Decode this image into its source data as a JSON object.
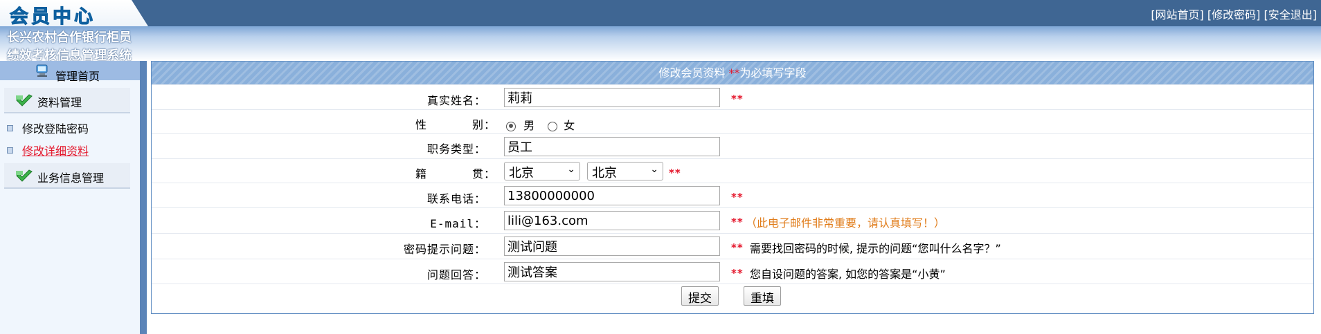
{
  "header": {
    "logo_text": "会员中心",
    "system_title_line1": "长兴农村合作银行柜员",
    "system_title_line2": "绩效考核信息管理系统",
    "links": [
      "[网站首页]",
      "[修改密码]",
      "[安全退出]"
    ]
  },
  "sidebar": {
    "home_label": "管理首页",
    "groups": [
      {
        "label": "资料管理",
        "items": [
          {
            "label": "修改登陆密码",
            "active": false
          },
          {
            "label": "修改详细资料",
            "active": true
          }
        ]
      },
      {
        "label": "业务信息管理",
        "items": []
      }
    ]
  },
  "form": {
    "header_title": "修改会员资料",
    "header_required_mark": "**",
    "header_required_text": "为必填写字段",
    "required_mark": "**",
    "fields": {
      "real_name": {
        "label": "真实姓名：",
        "value": "莉莉"
      },
      "gender": {
        "label_a": "性",
        "label_b": "别：",
        "options": [
          "男",
          "女"
        ],
        "selected": "男"
      },
      "job_type": {
        "label": "职务类型：",
        "value": "员工"
      },
      "origin": {
        "label_a": "籍",
        "label_b": "贯：",
        "province": "北京",
        "city": "北京"
      },
      "phone": {
        "label": "联系电话：",
        "value": "13800000000"
      },
      "email": {
        "label": "E-mail：",
        "value": "lili@163.com",
        "note": "（此电子邮件非常重要，请认真填写！）"
      },
      "question": {
        "label": "密码提示问题：",
        "value": "测试问题",
        "note": "需要找回密码的时候, 提示的问题“您叫什么名字？”"
      },
      "answer": {
        "label": "问题回答：",
        "value": "测试答案",
        "note": "您自设问题的答案, 如您的答案是“小黄”"
      }
    },
    "buttons": {
      "submit": "提交",
      "reset": "重填"
    }
  },
  "colors": {
    "topbar": "#3f6693",
    "required": "#e4162b",
    "note_orange": "#e07c1a",
    "form_header": "#8ab0db"
  }
}
